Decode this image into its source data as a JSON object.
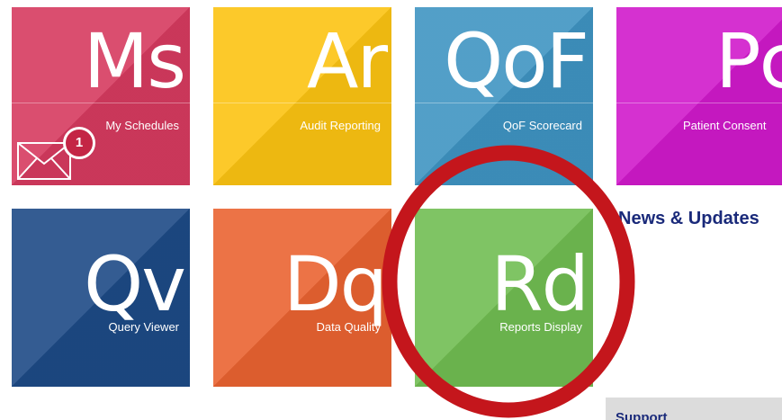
{
  "tiles": [
    {
      "abbr": "Ms",
      "label": "My Schedules"
    },
    {
      "abbr": "Ar",
      "label": "Audit Reporting"
    },
    {
      "abbr": "QoF",
      "label": "QoF Scorecard"
    },
    {
      "abbr": "Pc",
      "label": "Patient Consent"
    },
    {
      "abbr": "Qv",
      "label": "Query Viewer"
    },
    {
      "abbr": "Dq",
      "label": "Data Quality"
    },
    {
      "abbr": "Rd",
      "label": "Reports Display"
    }
  ],
  "notifications": {
    "icon": "envelope-icon",
    "count": "1"
  },
  "news": {
    "title": "News & Updates"
  },
  "support": {
    "label": "Support"
  },
  "colors": {
    "my_schedules": "#d63a5f",
    "audit_reporting": "#fcc312",
    "qof_scorecard": "#3f94c2",
    "patient_consent": "#d01acb",
    "query_viewer": "#1d4a86",
    "data_quality": "#ea6331",
    "reports_display": "#71bd52",
    "highlight_ring": "#c4161c",
    "heading_text": "#1a2a7a"
  }
}
